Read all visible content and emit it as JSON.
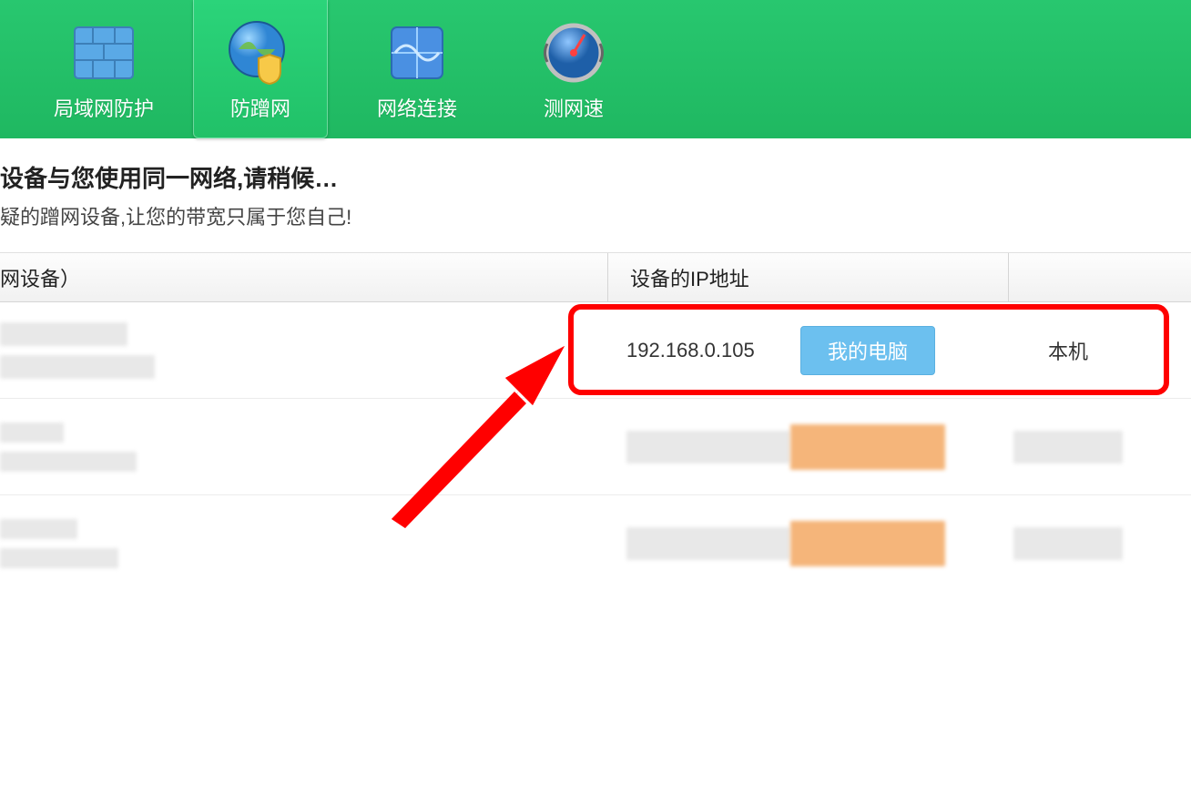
{
  "nav": {
    "items": [
      {
        "label": "局域网防护",
        "icon": "firewall-icon"
      },
      {
        "label": "防蹭网",
        "icon": "globe-shield-icon"
      },
      {
        "label": "网络连接",
        "icon": "network-icon"
      },
      {
        "label": "测网速",
        "icon": "speedometer-icon"
      }
    ],
    "active_index": 1
  },
  "subheader": {
    "line1": "设备与您使用同一网络,请稍候…",
    "line2": "疑的蹭网设备,让您的带宽只属于您自己!"
  },
  "table": {
    "col_device": "网设备）",
    "col_ip": "设备的IP地址"
  },
  "row1": {
    "ip": "192.168.0.105",
    "btn_label": "我的电脑",
    "status": "本机"
  }
}
